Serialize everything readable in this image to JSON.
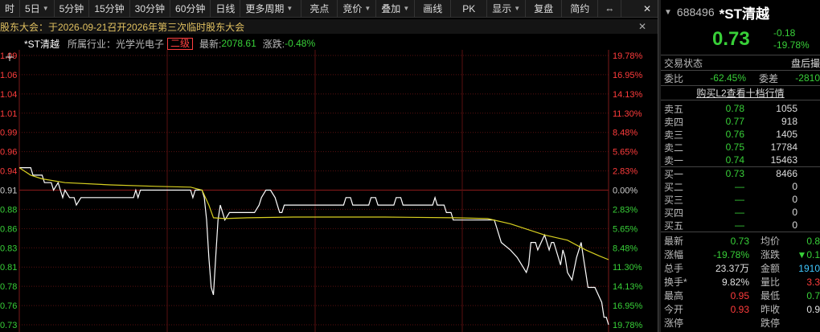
{
  "toolbar": {
    "items": [
      "时",
      "5日",
      "5分钟",
      "15分钟",
      "30分钟",
      "60分钟",
      "日线",
      "更多周期",
      "亮点",
      "竞价",
      "叠加",
      "画线",
      "PK",
      "显示",
      "复盘",
      "简约"
    ]
  },
  "notice": {
    "text": "股东大会：于2026-09-21召开2026年第三次临时股东大会"
  },
  "info": {
    "name": "*ST清越",
    "industry": "所属行业：光学光电子",
    "level": "二级",
    "latest_label": "最新:",
    "latest_value": "2078.61",
    "change_label": "涨跌:",
    "change_value": "-0.48%"
  },
  "chart_data": {
    "type": "line",
    "title": "",
    "prev_close": 0.91,
    "ylim": [
      0.73,
      1.09
    ],
    "left_ticks": [
      "1.09",
      "1.06",
      "1.04",
      "1.01",
      "0.99",
      "0.96",
      "0.94",
      "0.91",
      "0.88",
      "0.86",
      "0.83",
      "0.81",
      "0.78",
      "0.76",
      "0.73"
    ],
    "right_ticks": [
      "19.78%",
      "16.95%",
      "14.13%",
      "11.30%",
      "8.48%",
      "5.65%",
      "2.83%",
      "0.00%",
      "2.83%",
      "5.65%",
      "8.48%",
      "11.30%",
      "14.13%",
      "16.95%",
      "19.78%"
    ],
    "n_points": 241,
    "series": [
      {
        "name": "price",
        "color": "#ffffff",
        "points": [
          [
            0,
            0.94
          ],
          [
            5,
            0.94
          ],
          [
            6,
            0.93
          ],
          [
            10,
            0.93
          ],
          [
            11,
            0.92
          ],
          [
            14,
            0.92
          ],
          [
            15,
            0.91
          ],
          [
            17,
            0.92
          ],
          [
            18,
            0.91
          ],
          [
            19,
            0.9
          ],
          [
            20,
            0.91
          ],
          [
            22,
            0.9
          ],
          [
            24,
            0.9
          ],
          [
            25,
            0.89
          ],
          [
            27,
            0.9
          ],
          [
            50,
            0.9
          ],
          [
            51,
            0.91
          ],
          [
            52,
            0.9
          ],
          [
            53,
            0.91
          ],
          [
            75,
            0.91
          ],
          [
            76,
            0.9
          ],
          [
            77,
            0.91
          ],
          [
            80,
            0.91
          ],
          [
            81,
            0.9
          ],
          [
            82,
            0.87
          ],
          [
            83,
            0.82
          ],
          [
            84,
            0.78
          ],
          [
            85,
            0.77
          ],
          [
            86,
            0.82
          ],
          [
            87,
            0.87
          ],
          [
            88,
            0.89
          ],
          [
            89,
            0.88
          ],
          [
            90,
            0.87
          ],
          [
            92,
            0.88
          ],
          [
            103,
            0.88
          ],
          [
            105,
            0.89
          ],
          [
            106,
            0.9
          ],
          [
            108,
            0.91
          ],
          [
            110,
            0.91
          ],
          [
            112,
            0.9
          ],
          [
            113,
            0.89
          ],
          [
            114,
            0.88
          ],
          [
            115,
            0.88
          ],
          [
            116,
            0.89
          ],
          [
            142,
            0.89
          ],
          [
            143,
            0.9
          ],
          [
            145,
            0.9
          ],
          [
            146,
            0.89
          ],
          [
            153,
            0.89
          ],
          [
            154,
            0.9
          ],
          [
            156,
            0.9
          ],
          [
            157,
            0.89
          ],
          [
            164,
            0.89
          ],
          [
            165,
            0.9
          ],
          [
            167,
            0.9
          ],
          [
            168,
            0.89
          ],
          [
            181,
            0.89
          ],
          [
            182,
            0.9
          ],
          [
            183,
            0.89
          ],
          [
            186,
            0.89
          ],
          [
            187,
            0.88
          ],
          [
            189,
            0.88
          ],
          [
            190,
            0.87
          ],
          [
            208,
            0.87
          ],
          [
            209,
            0.86
          ],
          [
            211,
            0.84
          ],
          [
            215,
            0.83
          ],
          [
            218,
            0.82
          ],
          [
            220,
            0.81
          ],
          [
            222,
            0.8
          ],
          [
            223,
            0.81
          ],
          [
            224,
            0.84
          ],
          [
            226,
            0.84
          ],
          [
            227,
            0.83
          ],
          [
            230,
            0.85
          ],
          [
            231,
            0.84
          ],
          [
            232,
            0.83
          ],
          [
            233,
            0.84
          ],
          [
            234,
            0.84
          ],
          [
            235,
            0.83
          ],
          [
            237,
            0.81
          ],
          [
            238,
            0.83
          ],
          [
            239,
            0.82
          ],
          [
            240,
            0.8
          ],
          [
            242,
            0.79
          ],
          [
            244,
            0.82
          ],
          [
            245,
            0.83
          ],
          [
            246,
            0.84
          ],
          [
            247,
            0.82
          ],
          [
            248,
            0.8
          ],
          [
            249,
            0.78
          ],
          [
            252,
            0.78
          ],
          [
            255,
            0.76
          ],
          [
            256,
            0.74
          ],
          [
            257,
            0.74
          ],
          [
            258,
            0.73
          ]
        ]
      },
      {
        "name": "average",
        "color": "#d8d020",
        "points": [
          [
            0,
            0.94
          ],
          [
            5,
            0.93
          ],
          [
            10,
            0.925
          ],
          [
            20,
            0.92
          ],
          [
            40,
            0.917
          ],
          [
            60,
            0.915
          ],
          [
            75,
            0.914
          ],
          [
            80,
            0.91
          ],
          [
            83,
            0.89
          ],
          [
            85,
            0.873
          ],
          [
            90,
            0.872
          ],
          [
            100,
            0.873
          ],
          [
            120,
            0.874
          ],
          [
            160,
            0.874
          ],
          [
            190,
            0.873
          ],
          [
            205,
            0.872
          ],
          [
            215,
            0.865
          ],
          [
            230,
            0.85
          ],
          [
            240,
            0.843
          ],
          [
            248,
            0.83
          ],
          [
            254,
            0.822
          ],
          [
            258,
            0.817
          ]
        ]
      }
    ]
  },
  "panel": {
    "code": "688496",
    "name": "*ST清越",
    "price": "0.73",
    "change": "-0.18",
    "change_pct": "-19.78%",
    "status_label": "交易状态",
    "status_value": "盘后撮",
    "weibi_label": "委比",
    "weibi_value": "-62.45%",
    "weicha_label": "委差",
    "weicha_value": "-2810",
    "l2_link": "购买L2查看十档行情",
    "asks": [
      {
        "label": "卖五",
        "price": "0.78",
        "vol": "1055"
      },
      {
        "label": "卖四",
        "price": "0.77",
        "vol": "918"
      },
      {
        "label": "卖三",
        "price": "0.76",
        "vol": "1405"
      },
      {
        "label": "卖二",
        "price": "0.75",
        "vol": "17784"
      },
      {
        "label": "卖一",
        "price": "0.74",
        "vol": "15463"
      }
    ],
    "bids": [
      {
        "label": "买一",
        "price": "0.73",
        "vol": "8466"
      },
      {
        "label": "买二",
        "price": "—",
        "vol": "0"
      },
      {
        "label": "买三",
        "price": "—",
        "vol": "0"
      },
      {
        "label": "买四",
        "price": "—",
        "vol": "0"
      },
      {
        "label": "买五",
        "price": "—",
        "vol": "0"
      }
    ],
    "stats": [
      {
        "k": "最新",
        "v": "0.73",
        "k2": "均价",
        "v2": "0.8"
      },
      {
        "k": "涨幅",
        "v": "-19.78%",
        "k2": "涨跌",
        "v2": "▼0.1"
      },
      {
        "k": "总手",
        "v": "23.37万",
        "k2": "金额",
        "v2": "1910"
      },
      {
        "k": "换手*",
        "v": "9.82%",
        "k2": "量比",
        "v2": "3.3"
      },
      {
        "k": "最高",
        "v": "0.95",
        "k2": "最低",
        "v2": "0.7"
      },
      {
        "k": "今开",
        "v": "0.93",
        "k2": "昨收",
        "v2": "0.9"
      },
      {
        "k": "涨停",
        "v": "",
        "k2": "跌停",
        "v2": ""
      }
    ]
  }
}
